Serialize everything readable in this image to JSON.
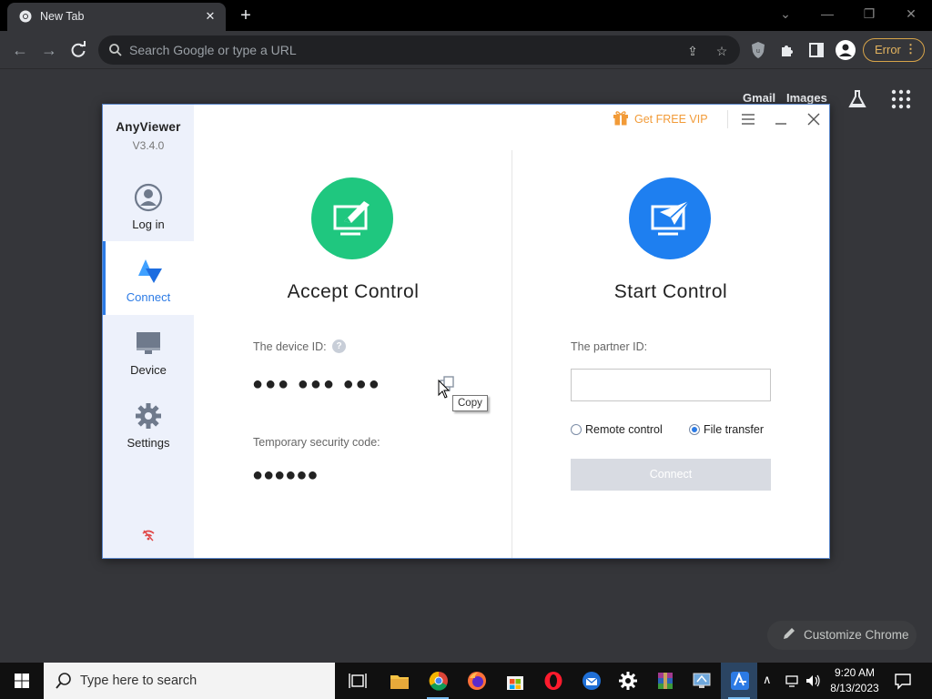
{
  "browser": {
    "tab_title": "New Tab",
    "omnibox_placeholder": "Search Google or type a URL",
    "error_label": "Error",
    "ntp_links": {
      "gmail": "Gmail",
      "images": "Images"
    },
    "customize_label": "Customize Chrome"
  },
  "anyviewer": {
    "app_name": "AnyViewer",
    "version": "V3.4.0",
    "vip_label": "Get FREE VIP",
    "sidebar": [
      {
        "label": "Log in",
        "icon": "user-icon"
      },
      {
        "label": "Connect",
        "icon": "connect-icon",
        "active": true
      },
      {
        "label": "Device",
        "icon": "monitor-icon"
      },
      {
        "label": "Settings",
        "icon": "gear-icon"
      }
    ],
    "accept": {
      "title": "Accept Control",
      "device_id_label": "The device ID:",
      "device_id_value": "●●● ●●● ●●●",
      "security_code_label": "Temporary security code:",
      "security_code_value": "●●●●●●",
      "copy_tooltip": "Copy"
    },
    "start": {
      "title": "Start Control",
      "partner_id_label": "The partner ID:",
      "partner_id_value": "",
      "remote_control_label": "Remote control",
      "file_transfer_label": "File transfer",
      "selected_mode": "File transfer",
      "connect_label": "Connect"
    },
    "colors": {
      "accept_green": "#1fc77f",
      "start_blue": "#1e7ff0",
      "accent": "#2c7be5",
      "vip_orange": "#f29b38"
    }
  },
  "taskbar": {
    "search_placeholder": "Type here to search",
    "time": "9:20 AM",
    "date": "8/13/2023"
  }
}
